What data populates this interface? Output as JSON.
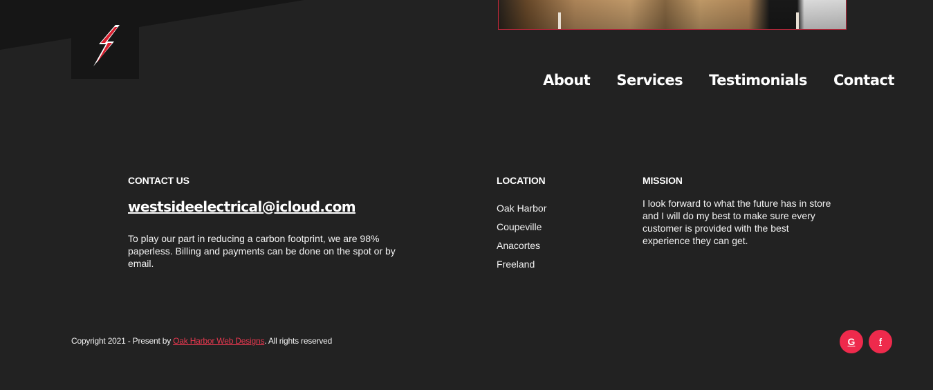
{
  "header": {
    "logo_icon": "lightning-bolt-icon",
    "nav": [
      "About",
      "Services",
      "Testimonials",
      "Contact"
    ]
  },
  "footer": {
    "contact": {
      "title": "CONTACT US",
      "email": "westsideelectrical@icloud.com",
      "text": "To play our part in reducing a carbon footprint, we are 98% paperless. Billing and payments can be done on the spot or by email."
    },
    "location": {
      "title": "LOCATION",
      "items": [
        "Oak Harbor",
        "Coupeville",
        "Anacortes",
        "Freeland"
      ]
    },
    "mission": {
      "title": "MISSION",
      "text": "I look forward to what the future has in store and I will do my best to make sure every customer is provided with the best experience they can get."
    },
    "copyright": {
      "prefix": "Copyright 2021 - Present by ",
      "link": "Oak Harbor Web Designs",
      "suffix": ". All rights reserved"
    },
    "social": [
      {
        "icon": "google-icon",
        "glyph": "G"
      },
      {
        "icon": "facebook-icon",
        "glyph": "f"
      }
    ]
  },
  "colors": {
    "background": "#222222",
    "accent": "#ee2a4c"
  }
}
